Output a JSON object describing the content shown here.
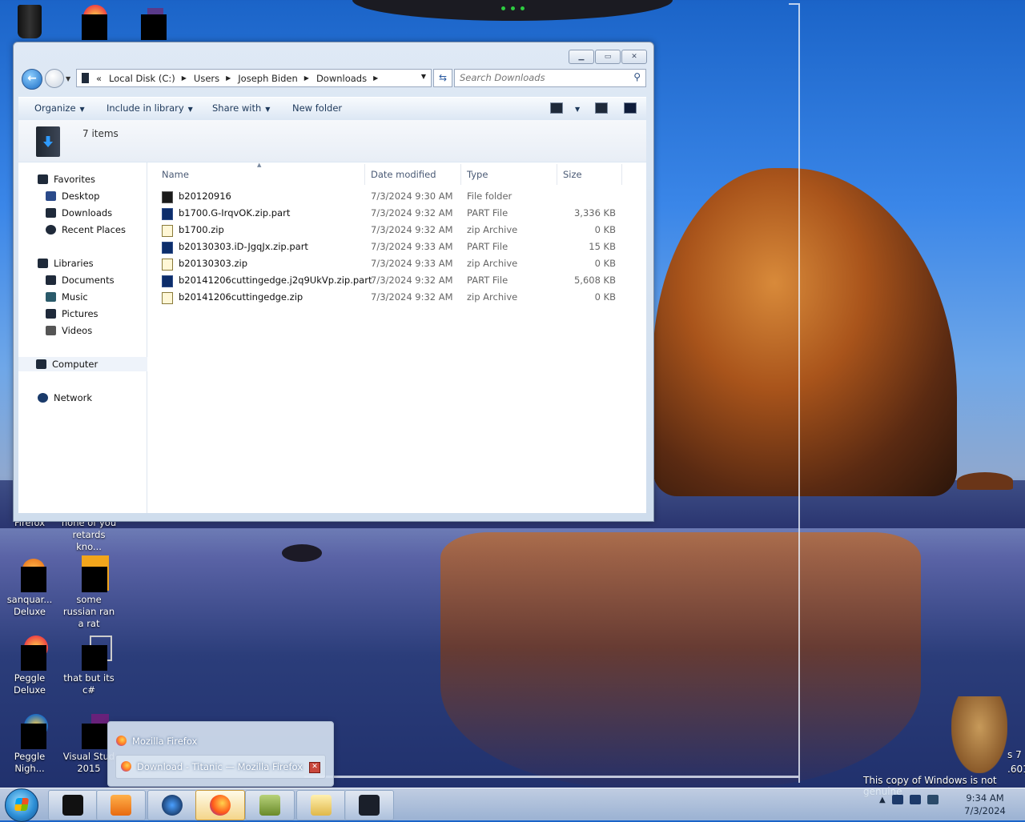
{
  "explorer": {
    "address": {
      "chevron": "«",
      "segments": [
        "Local Disk (C:)",
        "Users",
        "Joseph Biden",
        "Downloads"
      ]
    },
    "search_placeholder": "Search Downloads",
    "toolbar": {
      "organize": "Organize",
      "include_in_library": "Include in library",
      "share_with": "Share with",
      "new_folder": "New folder"
    },
    "details": {
      "item_count": "7 items"
    },
    "nav": {
      "favorites": "Favorites",
      "desktop": "Desktop",
      "downloads": "Downloads",
      "recent_places": "Recent Places",
      "libraries": "Libraries",
      "documents": "Documents",
      "music": "Music",
      "pictures": "Pictures",
      "videos": "Videos",
      "computer": "Computer",
      "network": "Network"
    },
    "columns": {
      "name": "Name",
      "date": "Date modified",
      "type": "Type",
      "size": "Size"
    },
    "files": [
      {
        "name": "b20120916",
        "date": "7/3/2024 9:30 AM",
        "type": "File folder",
        "size": "",
        "icon": "folder-icon"
      },
      {
        "name": "b1700.G-IrqvOK.zip.part",
        "date": "7/3/2024 9:32 AM",
        "type": "PART File",
        "size": "3,336 KB",
        "icon": "part-file-icon"
      },
      {
        "name": "b1700.zip",
        "date": "7/3/2024 9:32 AM",
        "type": "zip Archive",
        "size": "0 KB",
        "icon": "zip-icon"
      },
      {
        "name": "b20130303.iD-JgqJx.zip.part",
        "date": "7/3/2024 9:33 AM",
        "type": "PART File",
        "size": "15 KB",
        "icon": "part-file-icon"
      },
      {
        "name": "b20130303.zip",
        "date": "7/3/2024 9:33 AM",
        "type": "zip Archive",
        "size": "0 KB",
        "icon": "zip-icon"
      },
      {
        "name": "b20141206cuttingedge.j2q9UkVp.zip.part",
        "date": "7/3/2024 9:32 AM",
        "type": "PART File",
        "size": "5,608 KB",
        "icon": "part-file-icon"
      },
      {
        "name": "b20141206cuttingedge.zip",
        "date": "7/3/2024 9:32 AM",
        "type": "zip Archive",
        "size": "0 KB",
        "icon": "zip-icon"
      }
    ]
  },
  "desktop_icons": {
    "firefox": "Firefox",
    "none_of_you": "none of you retards kno...",
    "sanquarium": "sanquar... Deluxe",
    "russian": "some russian ran a rat",
    "peggle_deluxe": "Peggle Deluxe",
    "csharp": "that but its c#",
    "peggle_nights": "Peggle Nigh...",
    "visual_studio": "Visual Stud 2015"
  },
  "popup": {
    "title": "Mozilla Firefox",
    "window": "Download - Titanic — Mozilla Firefox"
  },
  "watermark": {
    "line1": "This copy of Windows is not genuine",
    "partial_a": "s 7",
    "partial_b": ".601"
  },
  "clock": {
    "time": "9:34 AM",
    "date": "7/3/2024"
  }
}
